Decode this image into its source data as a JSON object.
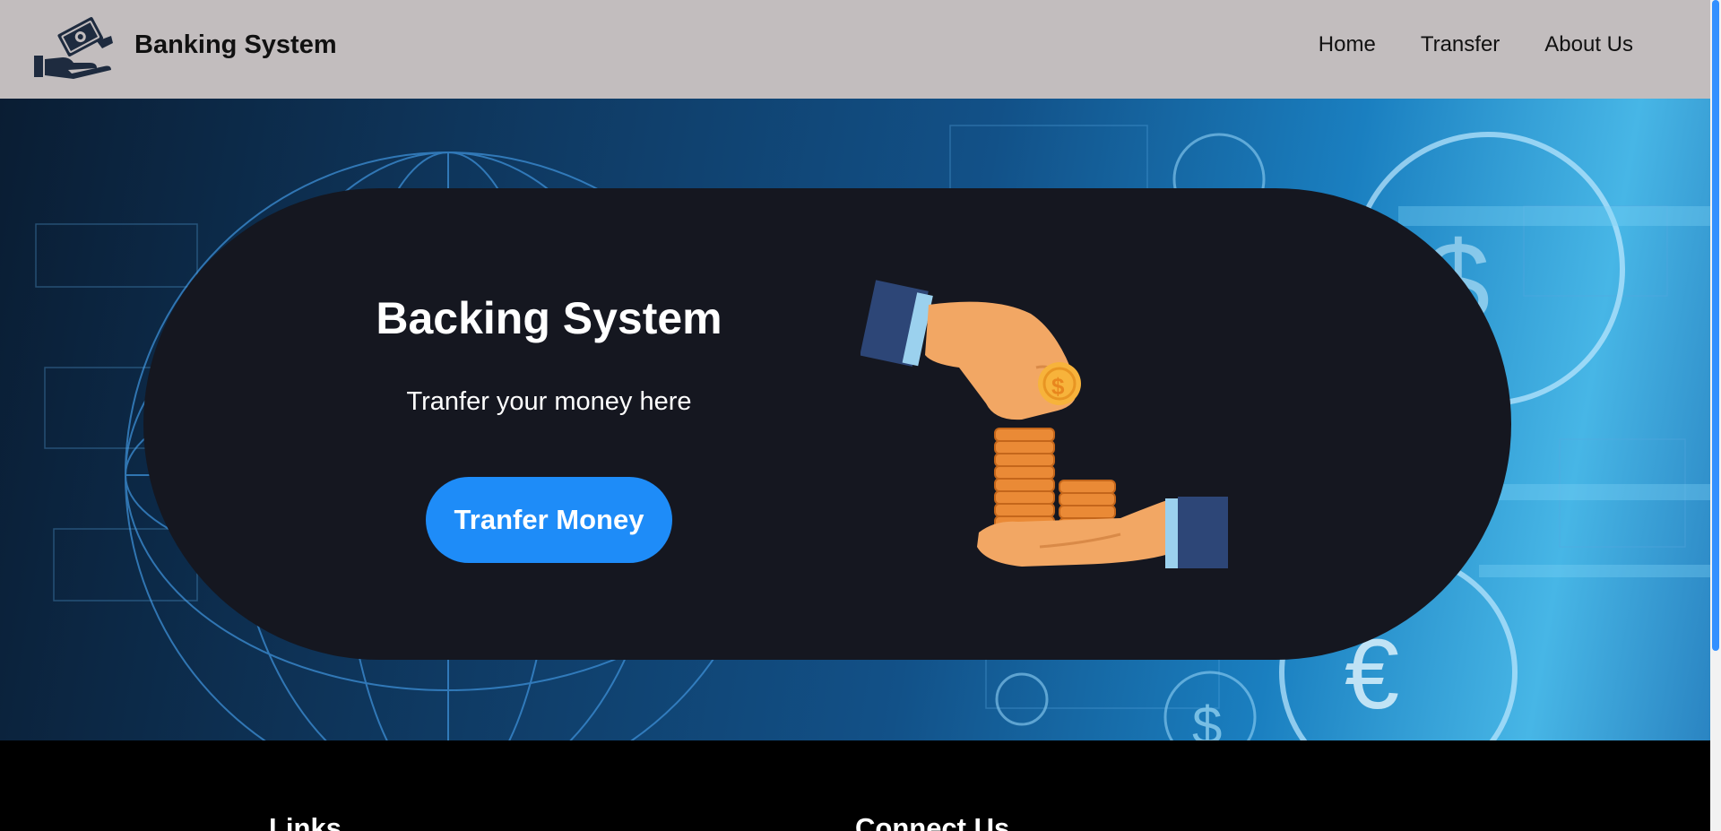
{
  "header": {
    "brand": "Banking System",
    "nav": {
      "home": "Home",
      "transfer": "Transfer",
      "about": "About Us"
    }
  },
  "hero": {
    "title": "Backing System",
    "subtitle": "Tranfer your money here",
    "button_label": "Tranfer Money"
  },
  "footer": {
    "links_heading": "Links",
    "connect_heading": "Connect Us"
  },
  "colors": {
    "header_bg": "#c2bdbe",
    "pill_bg": "#151720",
    "accent": "#1e8cf8",
    "footer_bg": "#000000"
  },
  "icons": {
    "logo": "money-hand-icon",
    "illustration": "coin-hands-illustration"
  }
}
